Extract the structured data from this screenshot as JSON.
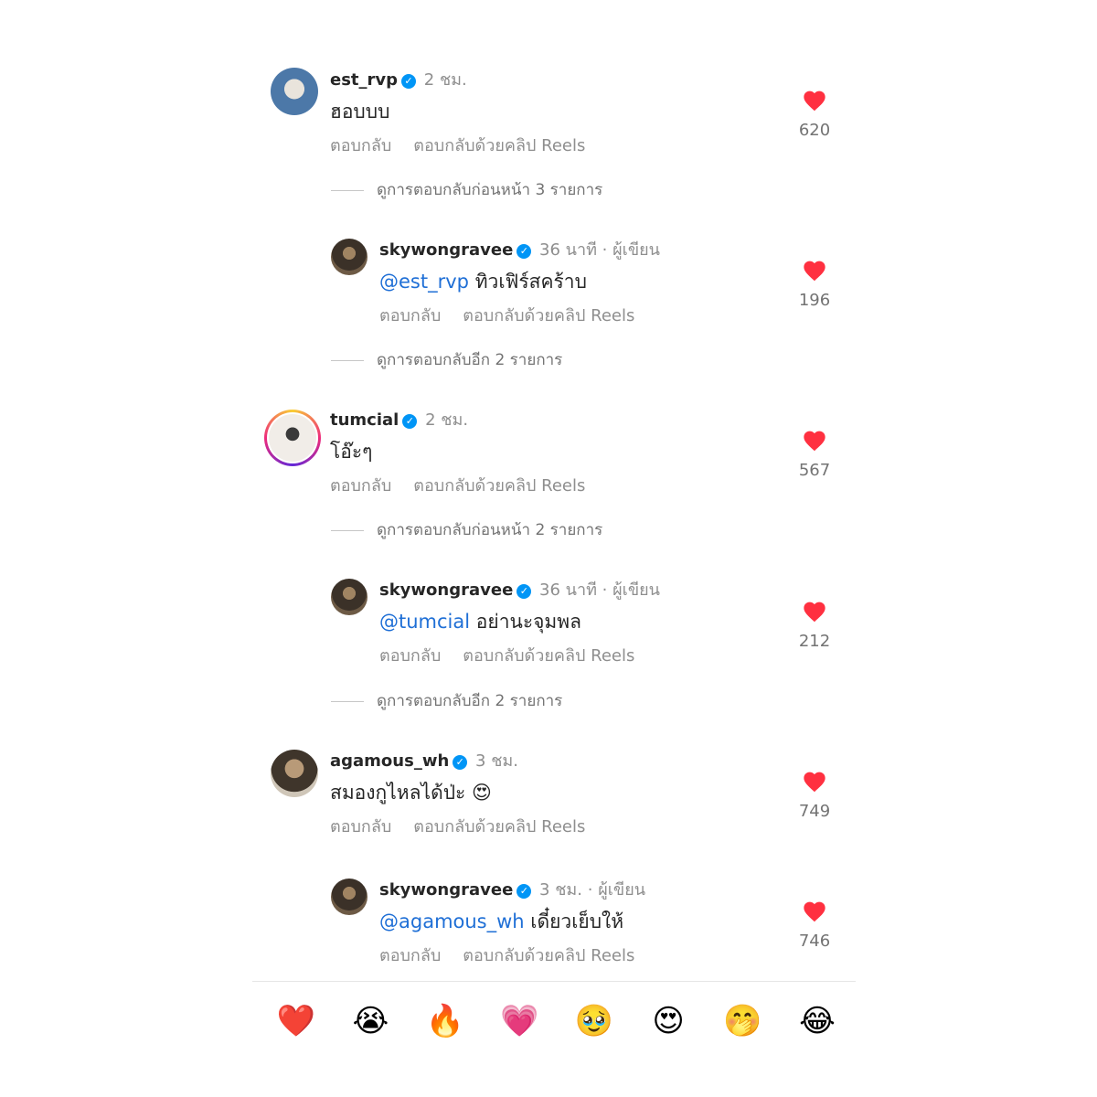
{
  "comments": [
    {
      "username": "est_rvp",
      "time": "2 ชม.",
      "author_tag": "",
      "mention": "",
      "text": "ฮอบบบ",
      "reply_label": "ตอบกลับ",
      "reels_label": "ตอบกลับด้วยคลิป Reels",
      "likes": "620",
      "view_more": "ดูการตอบกลับก่อนหน้า 3 รายการ"
    },
    {
      "username": "skywongravee",
      "time": "36 นาที",
      "author_tag": "· ผู้เขียน",
      "mention": "@est_rvp",
      "text": "ทิวเฟิร์สคร้าบ",
      "reply_label": "ตอบกลับ",
      "reels_label": "ตอบกลับด้วยคลิป Reels",
      "likes": "196",
      "view_more": "ดูการตอบกลับอีก 2 รายการ"
    },
    {
      "username": "tumcial",
      "time": "2 ชม.",
      "author_tag": "",
      "mention": "",
      "text": "โอ๊ะๆ",
      "reply_label": "ตอบกลับ",
      "reels_label": "ตอบกลับด้วยคลิป Reels",
      "likes": "567",
      "view_more": "ดูการตอบกลับก่อนหน้า 2 รายการ"
    },
    {
      "username": "skywongravee",
      "time": "36 นาที",
      "author_tag": "· ผู้เขียน",
      "mention": "@tumcial",
      "text": "อย่านะจุมพล",
      "reply_label": "ตอบกลับ",
      "reels_label": "ตอบกลับด้วยคลิป Reels",
      "likes": "212",
      "view_more": "ดูการตอบกลับอีก 2 รายการ"
    },
    {
      "username": "agamous_wh",
      "time": "3 ชม.",
      "author_tag": "",
      "mention": "",
      "text": "สมองกูไหลได้ป่ะ 😍",
      "reply_label": "ตอบกลับ",
      "reels_label": "ตอบกลับด้วยคลิป Reels",
      "likes": "749"
    },
    {
      "username": "skywongravee",
      "time": "3 ชม.",
      "author_tag": "· ผู้เขียน",
      "mention": "@agamous_wh",
      "text": "เดี๋ยวเย็บให้",
      "reply_label": "ตอบกลับ",
      "reels_label": "ตอบกลับด้วยคลิป Reels",
      "likes": "746"
    }
  ],
  "verified_glyph": "✓",
  "colors": {
    "heart": "#ff3040",
    "mention": "#1f6fd6",
    "verified": "#0095f6"
  },
  "emoji_bar": [
    "❤️",
    "😭",
    "🔥",
    "💗",
    "🥹",
    "😍",
    "🤭",
    "😂"
  ]
}
